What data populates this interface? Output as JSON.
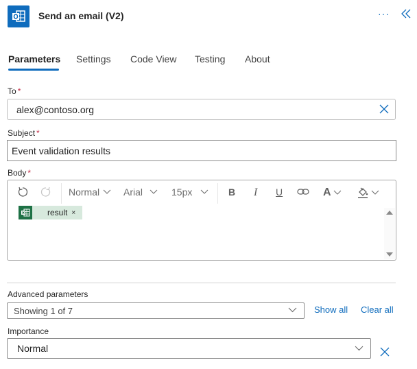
{
  "header": {
    "title": "Send an email (V2)",
    "app_icon": "outlook-icon",
    "more_label": "···",
    "brand_color": "#0f6cbd"
  },
  "tabs": [
    {
      "label": "Parameters",
      "active": true
    },
    {
      "label": "Settings",
      "active": false
    },
    {
      "label": "Code View",
      "active": false
    },
    {
      "label": "Testing",
      "active": false
    },
    {
      "label": "About",
      "active": false
    }
  ],
  "fields": {
    "to": {
      "label": "To",
      "required": "*",
      "value": "alex@contoso.org"
    },
    "subject": {
      "label": "Subject",
      "required": "*",
      "value": "Event validation results"
    },
    "body": {
      "label": "Body",
      "required": "*",
      "toolbar": {
        "paragraph_style": "Normal",
        "font": "Arial",
        "font_size": "15px",
        "bold": "B",
        "italic": "I",
        "underline": "U",
        "font_color": "A"
      },
      "token": {
        "label": "result",
        "remove": "×",
        "icon": "excel-icon"
      }
    }
  },
  "advanced": {
    "label": "Advanced parameters",
    "selected": "Showing 1 of 7",
    "show_all": "Show all",
    "clear_all": "Clear all"
  },
  "importance": {
    "label": "Importance",
    "value": "Normal"
  }
}
